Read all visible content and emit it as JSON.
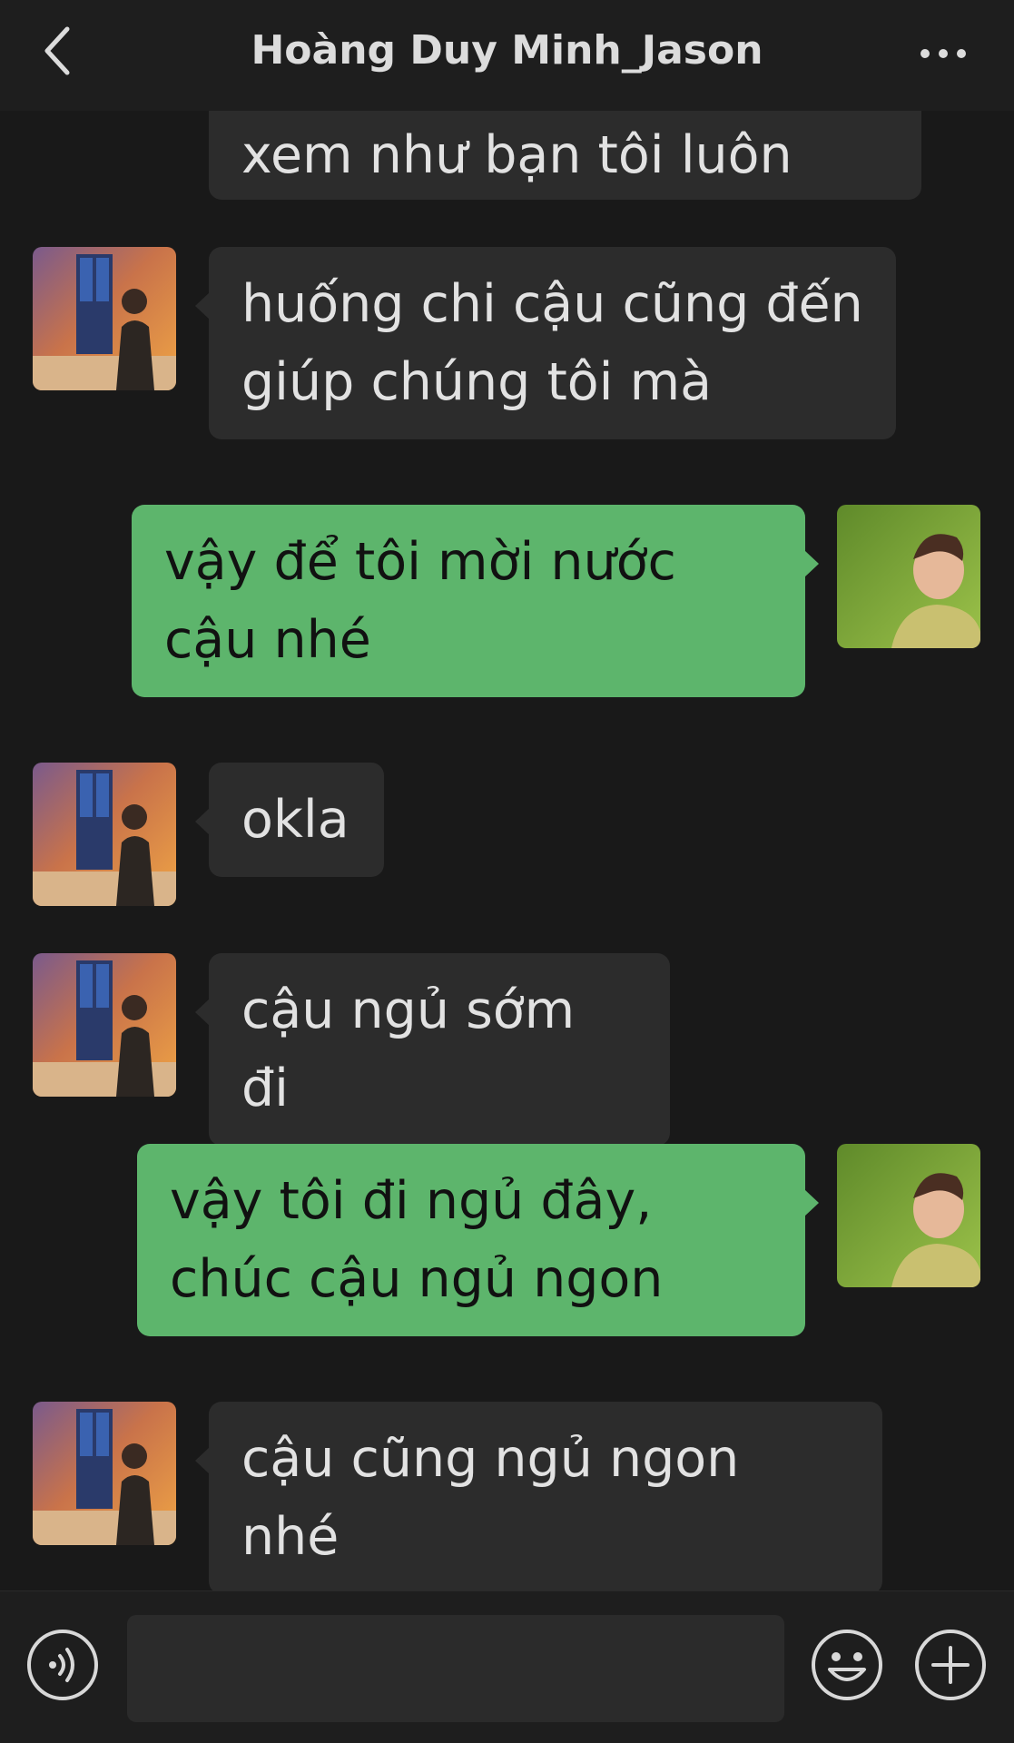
{
  "header": {
    "title": "Hoàng Duy Minh_Jason"
  },
  "colors": {
    "incoming_bubble": "#2c2c2c",
    "outgoing_bubble": "#5db56c",
    "background": "#191919"
  },
  "messages": [
    {
      "from": "other",
      "text": "xem như bạn tôi luôn"
    },
    {
      "from": "other",
      "text": "huống chi cậu cũng đến giúp chúng tôi mà"
    },
    {
      "from": "me",
      "text": "vậy để tôi mời nước cậu nhé"
    },
    {
      "from": "other",
      "text": "okla"
    },
    {
      "from": "other",
      "text": "cậu ngủ sớm đi"
    },
    {
      "from": "me",
      "text": "vậy tôi đi ngủ đây, chúc cậu ngủ ngon"
    },
    {
      "from": "other",
      "text": "cậu cũng ngủ ngon nhé"
    }
  ],
  "input_bar": {
    "voice_icon": "voice-icon",
    "emoji_icon": "emoji-icon",
    "plus_icon": "plus-icon"
  }
}
